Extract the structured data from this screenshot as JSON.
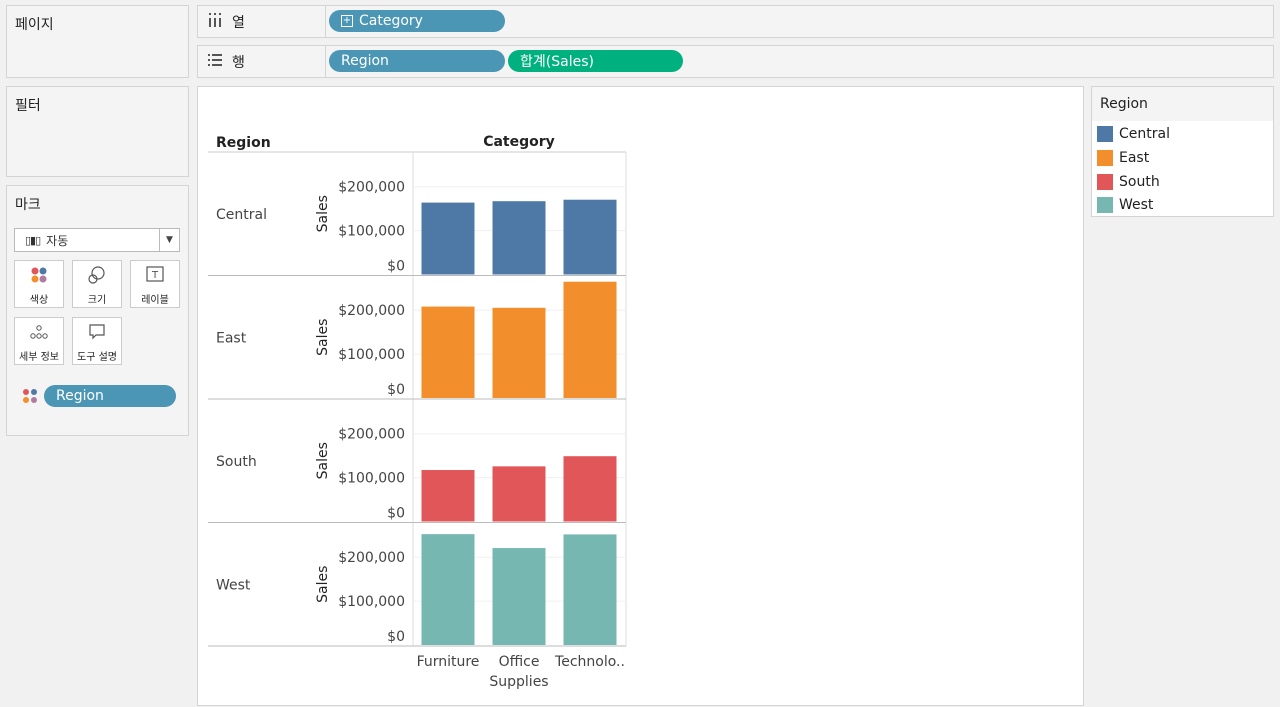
{
  "left_panels": {
    "pages_title": "페이지",
    "filters_title": "필터",
    "marks_title": "마크",
    "mark_type": "자동",
    "mark_buttons": [
      {
        "label": "색상",
        "icon": "color-dots-icon"
      },
      {
        "label": "크기",
        "icon": "size-icon"
      },
      {
        "label": "레이블",
        "icon": "label-icon"
      },
      {
        "label": "세부 정보",
        "icon": "detail-icon"
      },
      {
        "label": "도구 설명",
        "icon": "tooltip-icon"
      }
    ],
    "color_pill": "Region"
  },
  "shelves": {
    "columns_label": "열",
    "columns_icon": "columns-icon",
    "columns_pill": "Category",
    "rows_label": "행",
    "rows_icon": "rows-icon",
    "rows_pills": [
      "Region",
      "합계(Sales)"
    ]
  },
  "colors": {
    "Central": "#4e79a7",
    "East": "#f28e2b",
    "South": "#e15759",
    "West": "#76b7b2",
    "pill_blue": "#4a96b4",
    "pill_green": "#00b180"
  },
  "legend": {
    "title": "Region",
    "items": [
      "Central",
      "East",
      "South",
      "West"
    ]
  },
  "chart_data": {
    "type": "bar",
    "row_header": "Region",
    "column_header": "Category",
    "categories": [
      "Furniture",
      "Office Supplies",
      "Technology"
    ],
    "category_labels": [
      [
        "Furniture"
      ],
      [
        "Office",
        "Supplies"
      ],
      [
        "Technolo.."
      ]
    ],
    "ylabel": "Sales",
    "ylim": [
      0,
      270000
    ],
    "yticks": [
      0,
      100000,
      200000
    ],
    "ytick_labels": [
      "$0",
      "$100,000",
      "$200,000"
    ],
    "series": [
      {
        "name": "Central",
        "values": [
          163797,
          167026,
          170416
        ]
      },
      {
        "name": "East",
        "values": [
          208291,
          205516,
          264974
        ]
      },
      {
        "name": "South",
        "values": [
          117299,
          125651,
          148772
        ]
      },
      {
        "name": "West",
        "values": [
          252613,
          220853,
          251992
        ]
      }
    ]
  }
}
